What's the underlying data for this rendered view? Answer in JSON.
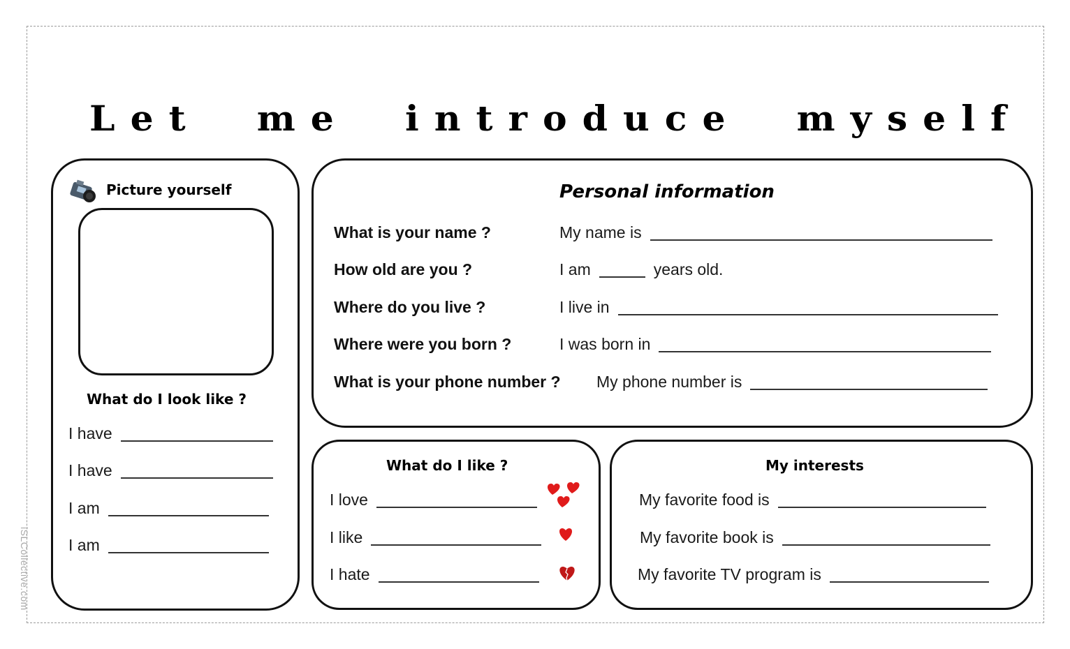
{
  "title": "Let me introduce myself",
  "watermark": "iSLCollective.com",
  "picture_section": {
    "heading": "Picture yourself",
    "icon": "camera-icon",
    "look_heading": "What do I look like ?",
    "lines": [
      {
        "prefix": "I have"
      },
      {
        "prefix": "I have"
      },
      {
        "prefix": "I am"
      },
      {
        "prefix": "I am"
      }
    ]
  },
  "personal_information": {
    "heading": "Personal information",
    "rows": [
      {
        "question": "What is your name ?",
        "answer_prefix": "My name is",
        "answer_suffix": ""
      },
      {
        "question": "How old are you ?",
        "answer_prefix": "I am",
        "answer_suffix": "years old."
      },
      {
        "question": "Where do you live ?",
        "answer_prefix": "I live in",
        "answer_suffix": ""
      },
      {
        "question": "Where were you born ?",
        "answer_prefix": "I was born in",
        "answer_suffix": ""
      },
      {
        "question": "What is your phone number ?",
        "answer_prefix": "My phone number is",
        "answer_suffix": ""
      }
    ]
  },
  "likes": {
    "heading": "What do I like ?",
    "rows": [
      {
        "prefix": "I love",
        "icon": "three-hearts-icon"
      },
      {
        "prefix": "I like",
        "icon": "heart-icon"
      },
      {
        "prefix": "I hate",
        "icon": "broken-heart-icon"
      }
    ],
    "heart_color": "#e01b1b",
    "broken_heart_color": "#c01818"
  },
  "interests": {
    "heading": "My interests",
    "rows": [
      {
        "prefix": "My favorite food is"
      },
      {
        "prefix": "My favorite book is"
      },
      {
        "prefix": "My favorite TV program is"
      }
    ]
  }
}
